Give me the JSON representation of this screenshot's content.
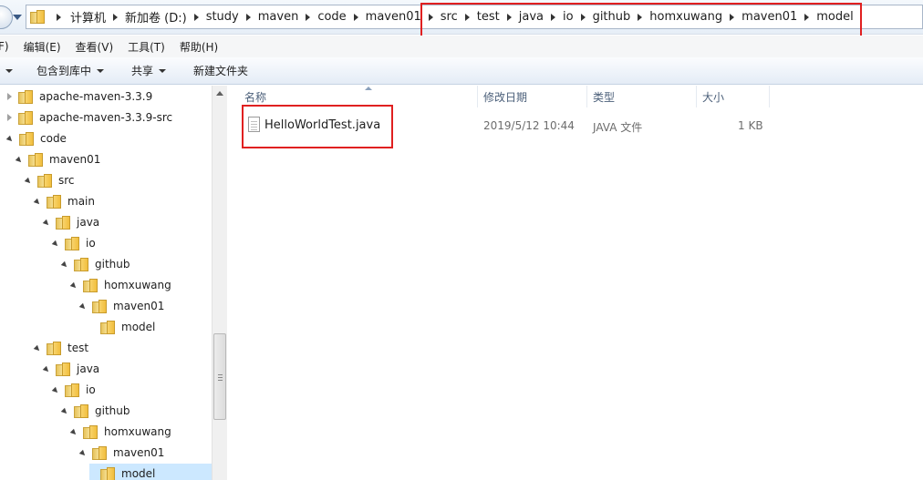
{
  "address_bar": {
    "path": [
      "计算机",
      "新加卷 (D:)",
      "study",
      "maven",
      "code",
      "maven01",
      "src",
      "test",
      "java",
      "io",
      "github",
      "homxuwang",
      "maven01",
      "model"
    ]
  },
  "menu": {
    "items": [
      "F)",
      "编辑(E)",
      "查看(V)",
      "工具(T)",
      "帮助(H)"
    ]
  },
  "toolbar": {
    "include_in_library": "包含到库中",
    "share": "共享",
    "new_folder": "新建文件夹"
  },
  "tree": {
    "items": [
      {
        "label": "apache-maven-3.3.9",
        "state": "closed"
      },
      {
        "label": "apache-maven-3.3.9-src",
        "state": "closed"
      },
      {
        "label": "code",
        "state": "open"
      },
      {
        "label": "maven01",
        "state": "open"
      },
      {
        "label": "src",
        "state": "open"
      },
      {
        "label": "main",
        "state": "open"
      },
      {
        "label": "java",
        "state": "open"
      },
      {
        "label": "io",
        "state": "open"
      },
      {
        "label": "github",
        "state": "open"
      },
      {
        "label": "homxuwang",
        "state": "open"
      },
      {
        "label": "maven01",
        "state": "open"
      },
      {
        "label": "model",
        "state": "none"
      },
      {
        "label": "test",
        "state": "open"
      },
      {
        "label": "java",
        "state": "open"
      },
      {
        "label": "io",
        "state": "open"
      },
      {
        "label": "github",
        "state": "open"
      },
      {
        "label": "homxuwang",
        "state": "open"
      },
      {
        "label": "maven01",
        "state": "open"
      },
      {
        "label": "model",
        "state": "none"
      }
    ]
  },
  "file_list": {
    "columns": [
      "名称",
      "修改日期",
      "类型",
      "大小"
    ],
    "rows": [
      {
        "name": "HelloWorldTest.java",
        "modified": "2019/5/12 10:44",
        "type": "JAVA 文件",
        "size": "1 KB"
      }
    ]
  },
  "colors": {
    "highlight_box": "#e02020",
    "selection": "#cce8ff"
  }
}
